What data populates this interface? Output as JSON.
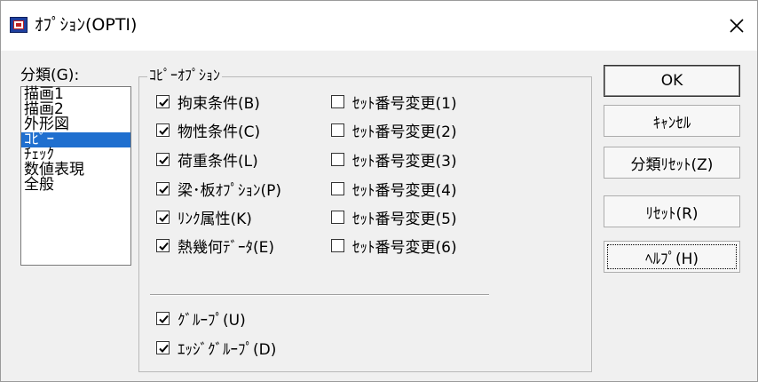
{
  "window": {
    "title": "ｵﾌﾟｼｮﾝ(OPTI)"
  },
  "category": {
    "label": "分類(G):",
    "items": [
      "描画1",
      "描画2",
      "外形図",
      "ｺﾋﾟｰ",
      "ﾁｪｯｸ",
      "数値表現",
      "全般"
    ],
    "selected_index": 3
  },
  "copy_options": {
    "title": "ｺﾋﾟｰｵﾌﾟｼｮﾝ",
    "left_items": [
      {
        "label": "拘束条件(B)",
        "checked": true
      },
      {
        "label": "物性条件(C)",
        "checked": true
      },
      {
        "label": "荷重条件(L)",
        "checked": true
      },
      {
        "label": "梁･板ｵﾌﾟｼｮﾝ(P)",
        "checked": true
      },
      {
        "label": "ﾘﾝｸ属性(K)",
        "checked": true
      },
      {
        "label": "熱幾何ﾃﾞｰﾀ(E)",
        "checked": true
      }
    ],
    "right_items": [
      {
        "label": "ｾｯﾄ番号変更(1)",
        "checked": false
      },
      {
        "label": "ｾｯﾄ番号変更(2)",
        "checked": false
      },
      {
        "label": "ｾｯﾄ番号変更(3)",
        "checked": false
      },
      {
        "label": "ｾｯﾄ番号変更(4)",
        "checked": false
      },
      {
        "label": "ｾｯﾄ番号変更(5)",
        "checked": false
      },
      {
        "label": "ｾｯﾄ番号変更(6)",
        "checked": false
      }
    ],
    "bottom_items": [
      {
        "label": "ｸﾞﾙｰﾌﾟ(U)",
        "checked": true
      },
      {
        "label": "ｴｯｼﾞｸﾞﾙｰﾌﾟ(D)",
        "checked": true
      }
    ]
  },
  "buttons": {
    "ok": "OK",
    "cancel": "ｷｬﾝｾﾙ",
    "category_reset": "分類ﾘｾｯﾄ(Z)",
    "reset": "ﾘｾｯﾄ(R)",
    "help": "ﾍﾙﾌﾟ(H)"
  }
}
